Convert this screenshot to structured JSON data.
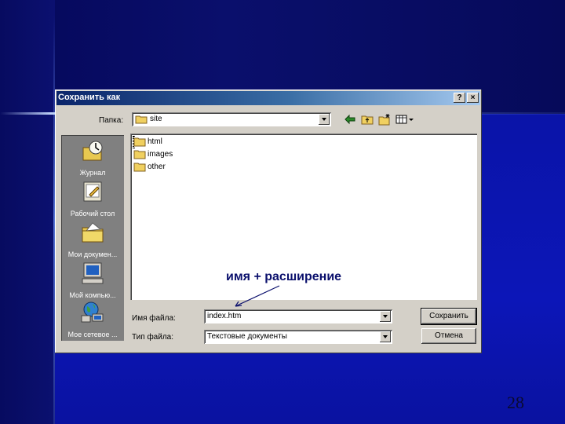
{
  "window": {
    "title": "Сохранить как",
    "help_button": "?",
    "close_button": "×"
  },
  "folder": {
    "label": "Папка:",
    "value": "site"
  },
  "toolbar": {
    "back_icon": "back-arrow-icon",
    "up_icon": "up-folder-icon",
    "new_folder_icon": "new-folder-icon",
    "view_icon": "view-menu-icon"
  },
  "places": [
    {
      "label": "Журнал",
      "icon": "history-icon"
    },
    {
      "label": "Рабочий стол",
      "icon": "desktop-icon"
    },
    {
      "label": "Мои докумен...",
      "icon": "my-documents-icon"
    },
    {
      "label": "Мой компью...",
      "icon": "my-computer-icon"
    },
    {
      "label": "Мое сетевое ...",
      "icon": "network-icon"
    }
  ],
  "files": [
    {
      "name": "html",
      "icon": "folder-icon"
    },
    {
      "name": "images",
      "icon": "folder-icon"
    },
    {
      "name": "other",
      "icon": "folder-icon"
    }
  ],
  "filename": {
    "label": "Имя файла:",
    "value": "index.htm"
  },
  "filetype": {
    "label": "Тип файла:",
    "value": "Текстовые документы"
  },
  "buttons": {
    "save": "Сохранить",
    "cancel": "Отмена"
  },
  "annotation": "имя + расширение",
  "slide_number": "28",
  "colors": {
    "title_start": "#0a246a",
    "title_end": "#a6caf0",
    "dialog_face": "#d4d0c8",
    "background": "#0c1278"
  }
}
